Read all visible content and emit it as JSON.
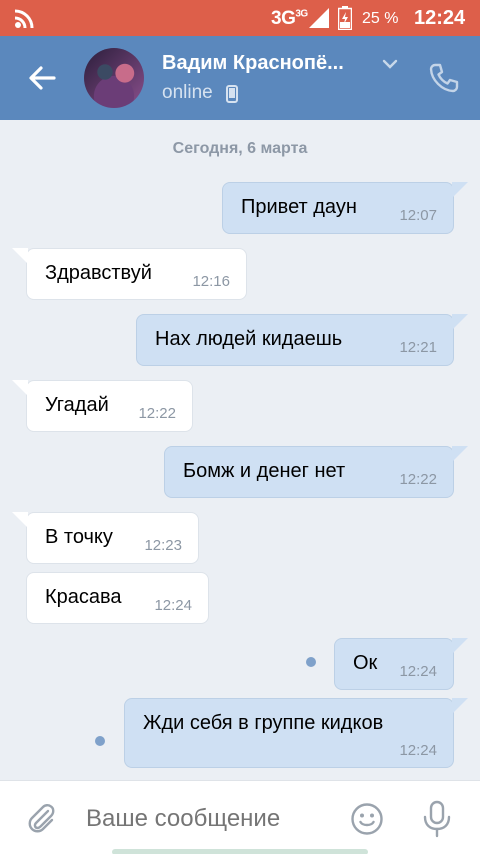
{
  "status_bar": {
    "network": "3G",
    "network_sup": "3G",
    "battery": "25 %",
    "time": "12:24"
  },
  "header": {
    "contact_name": "Вадим Краснопё...",
    "status": "online"
  },
  "date_divider": "Сегодня, 6 марта",
  "messages": [
    {
      "dir": "out",
      "text": "Привет даун",
      "time": "12:07"
    },
    {
      "dir": "in",
      "text": "Здравствуй",
      "time": "12:16"
    },
    {
      "dir": "out",
      "text": "Нах людей кидаешь",
      "time": "12:21"
    },
    {
      "dir": "in",
      "text": "Угадай",
      "time": "12:22"
    },
    {
      "dir": "out",
      "text": "Бомж и денег нет",
      "time": "12:22"
    },
    {
      "dir": "in",
      "text": "В точку",
      "time": "12:23"
    },
    {
      "dir": "in",
      "text": "Красава",
      "time": "12:24"
    },
    {
      "dir": "out",
      "text": "Ок",
      "time": "12:24",
      "unread": true
    },
    {
      "dir": "out",
      "text": "Жди себя в группе кидков",
      "time": "12:24",
      "unread": true
    }
  ],
  "composer": {
    "placeholder": "Ваше сообщение"
  },
  "colors": {
    "status_bar": "#dd5f4a",
    "header": "#5b88bd",
    "background": "#ebeff4",
    "outgoing_bubble": "#cfe0f3",
    "incoming_bubble": "#ffffff"
  },
  "icons": [
    "wifi-icon",
    "signal-icon",
    "battery-icon",
    "back-arrow-icon",
    "chevron-down-icon",
    "mobile-phone-icon",
    "call-icon",
    "attach-icon",
    "emoji-icon",
    "microphone-icon"
  ]
}
